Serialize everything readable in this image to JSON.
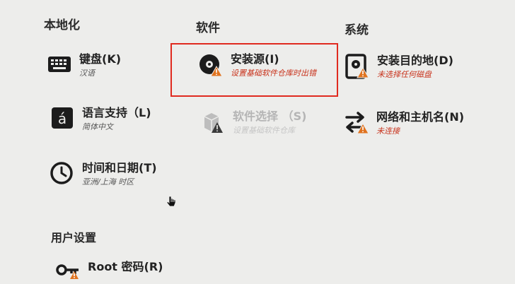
{
  "columns": {
    "localization": "本地化",
    "software": "软件",
    "system": "系统"
  },
  "items": {
    "keyboard": {
      "title": "键盘(K)",
      "subtitle": "汉语"
    },
    "language": {
      "title": "语言支持（L)",
      "subtitle": "简体中文"
    },
    "time": {
      "title": "时间和日期(T)",
      "subtitle": "亚洲/上海 时区"
    },
    "install_source": {
      "title": "安装源(I)",
      "subtitle": "设置基础软件仓库时出错"
    },
    "software_selection": {
      "title": "软件选择 （S)",
      "subtitle": "设置基础软件仓库"
    },
    "install_destination": {
      "title": "安装目的地(D)",
      "subtitle": "未选择任何磁盘"
    },
    "network": {
      "title": "网络和主机名(N)",
      "subtitle": "未连接"
    },
    "root_password": {
      "title": "Root 密码(R)"
    }
  },
  "user_settings": {
    "title": "用户设置"
  },
  "colors": {
    "highlight_border": "#e02a1f",
    "error_text": "#c8321b",
    "warning": "#e0731f"
  }
}
